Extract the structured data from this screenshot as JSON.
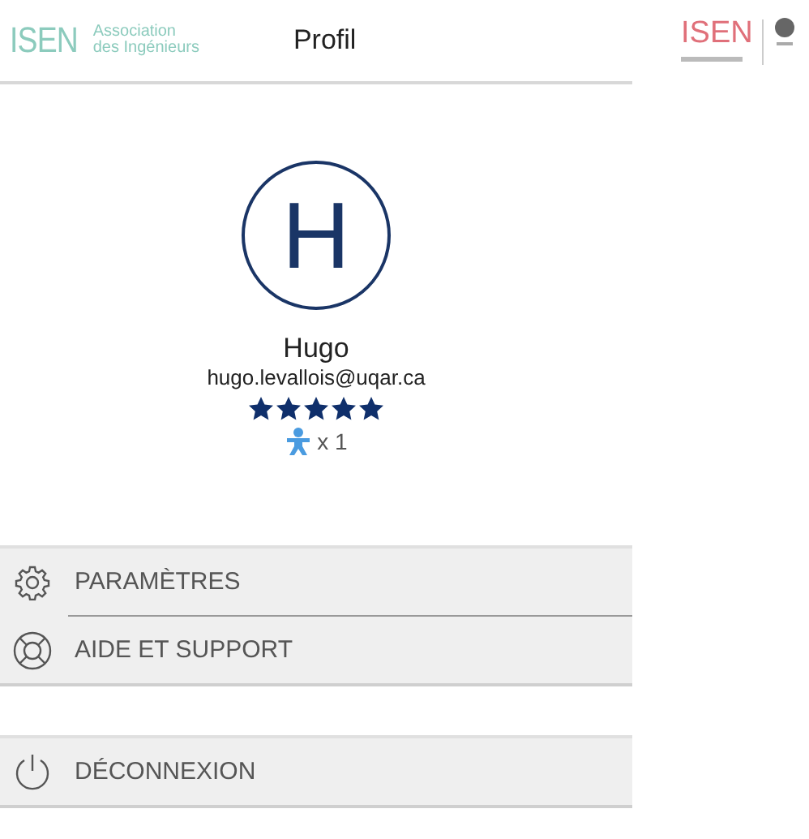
{
  "header": {
    "logo": {
      "mark": "ISEN",
      "line_1": "Association",
      "line_2": "des Ingénieurs"
    },
    "title": "Profil"
  },
  "side_logo": {
    "mark": "ISEN"
  },
  "profile": {
    "initial": "H",
    "name": "Hugo",
    "email": "hugo.levallois@uqar.ca",
    "stars": 5,
    "badge_count": "x 1"
  },
  "menu_groups": [
    {
      "items": [
        {
          "kind": "settings",
          "label": "PARAMÈTRES"
        },
        {
          "kind": "help",
          "label": "AIDE ET SUPPORT"
        }
      ]
    },
    {
      "items": [
        {
          "kind": "logout",
          "label": "DÉCONNEXION"
        }
      ]
    }
  ]
}
